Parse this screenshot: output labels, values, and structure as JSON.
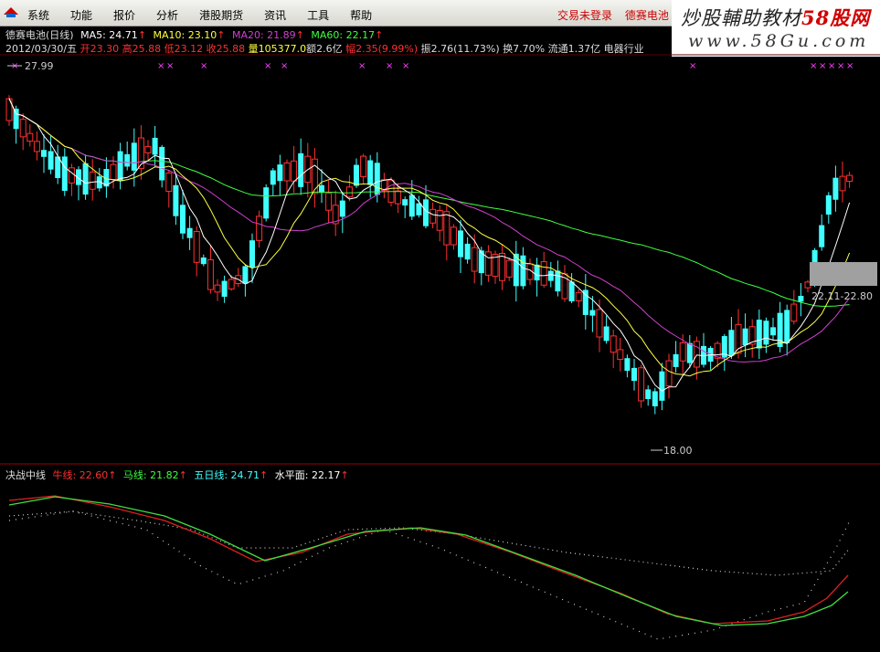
{
  "menu": [
    "系统",
    "功能",
    "报价",
    "分析",
    "港股期货",
    "资讯",
    "工具",
    "帮助"
  ],
  "status": {
    "trade": "交易未登录",
    "stock": "德赛电池"
  },
  "watermark": {
    "line1a": "炒股輔助教材",
    "line1b": "58股网",
    "line2": "www.58Gu.com"
  },
  "info": {
    "name": "德赛电池(日线)",
    "ma5": "MA5: 24.71",
    "ma10": "MA10: 23.10",
    "ma20": "MA20: 21.89",
    "ma60": "MA60: 22.17",
    "date": "2012/03/30/五",
    "open": "开23.30",
    "high": "高25.88",
    "low": "低23.12",
    "close": "收25.88",
    "vol": "量105377.0",
    "amount": "额2.6亿",
    "change": "幅2.35(9.99%)",
    "amp": "振2.76(11.73%)",
    "turnover": "换7.70%",
    "float": "流通1.37亿",
    "industry": "电器行业"
  },
  "main_chart": {
    "high_label": "27.99",
    "low_label": "18.00",
    "price_range": "22.11-22.80",
    "colors": {
      "up": "#ff3030",
      "down": "#40ffff",
      "ma5": "#ffffff",
      "ma10": "#ffff40",
      "ma20": "#d040d0",
      "ma60": "#40ff40"
    }
  },
  "sub_chart": {
    "title": "决战中线",
    "l1": "牛线: 22.60",
    "l2": "马线: 21.82",
    "l3": "五日线: 24.71",
    "l4": "水平面: 22.17"
  }
}
